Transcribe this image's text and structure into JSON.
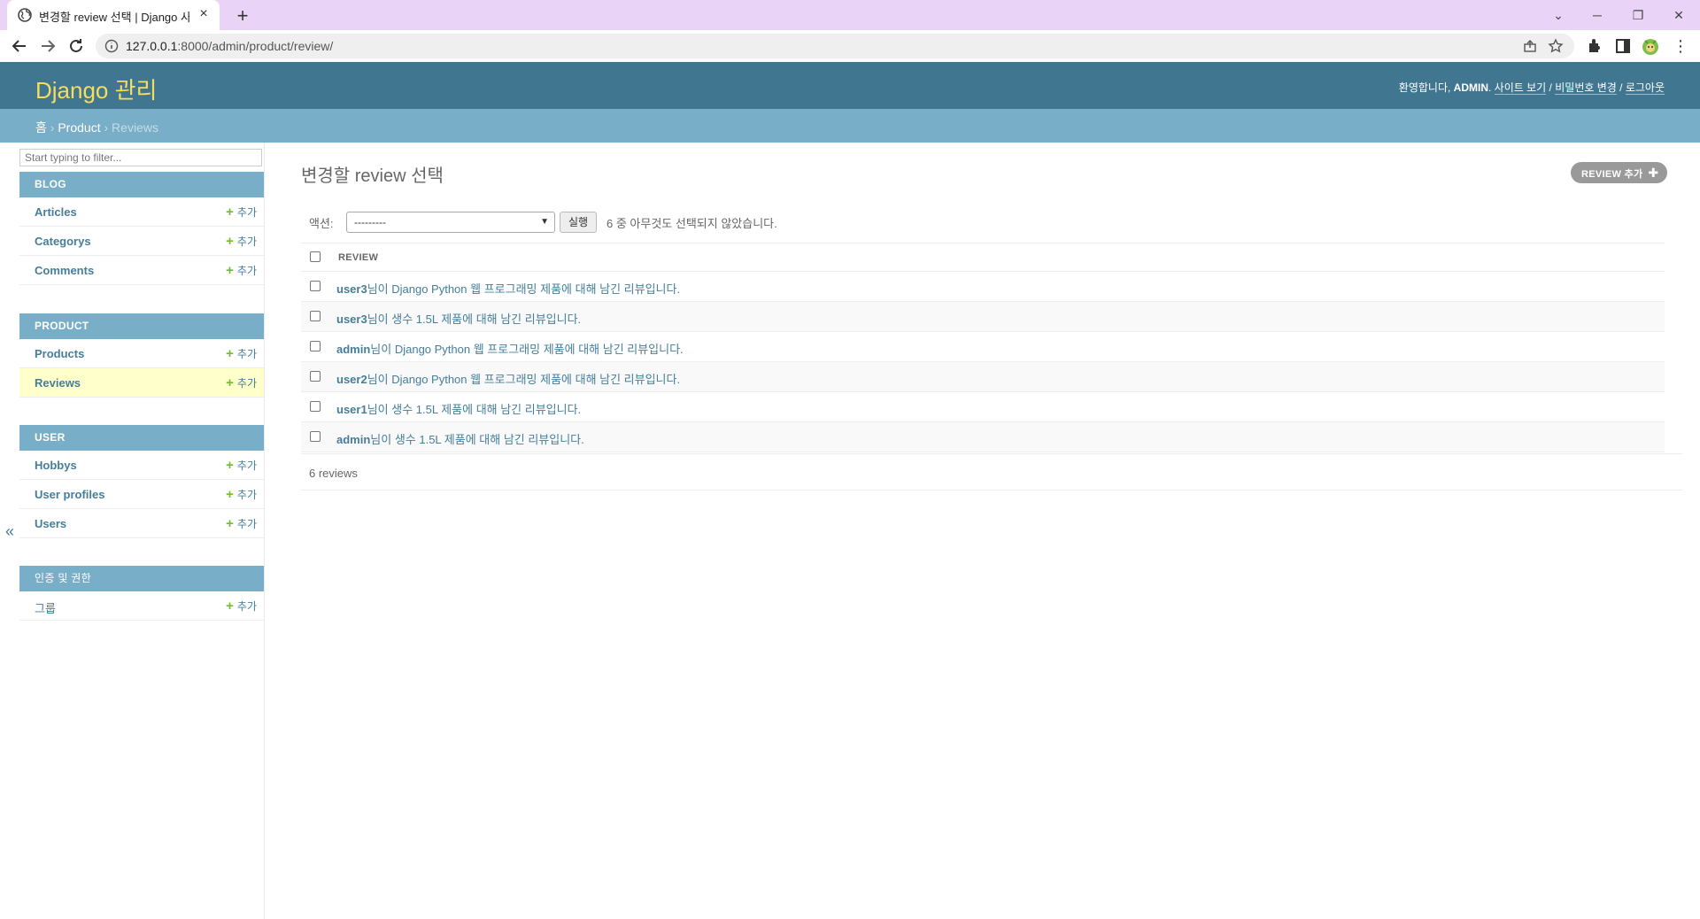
{
  "browser": {
    "tab_title": "변경할 review 선택 | Django 사이트 관리",
    "url_host": "127.0.0.1",
    "url_path": ":8000/admin/product/review/"
  },
  "header": {
    "brand": "Django 관리",
    "welcome": "환영합니다, ",
    "username": "ADMIN",
    "view_site": "사이트 보기",
    "change_password": "비밀번호 변경",
    "logout": "로그아웃",
    "separator": " / "
  },
  "breadcrumbs": {
    "home": "홈",
    "app": "Product",
    "current": "Reviews",
    "sep": " › "
  },
  "sidebar": {
    "filter_placeholder": "Start typing to filter...",
    "add_label": "추가",
    "modules": [
      {
        "caption": "BLOG",
        "models": [
          "Articles",
          "Categorys",
          "Comments"
        ]
      },
      {
        "caption": "PRODUCT",
        "models": [
          "Products",
          "Reviews"
        ]
      },
      {
        "caption": "USER",
        "models": [
          "Hobbys",
          "User profiles",
          "Users"
        ]
      },
      {
        "caption": "인증 및 권한",
        "models": [
          "그룹"
        ]
      }
    ],
    "collapse_label": "«"
  },
  "content": {
    "title": "변경할 review 선택",
    "add_button": "REVIEW 추가",
    "actions_label": "액션:",
    "action_selected": "---------",
    "run_button": "실행",
    "action_counter": "6 중 아무것도 선택되지 않았습니다.",
    "column_header": "REVIEW",
    "rows": [
      {
        "user": "user3",
        "text": "님이 Django Python 웹 프로그래밍 제품에 대해 남긴 리뷰입니다."
      },
      {
        "user": "user3",
        "text": "님이 생수 1.5L 제품에 대해 남긴 리뷰입니다."
      },
      {
        "user": "admin",
        "text": "님이 Django Python 웹 프로그래밍 제품에 대해 남긴 리뷰입니다."
      },
      {
        "user": "user2",
        "text": "님이 Django Python 웹 프로그래밍 제품에 대해 남긴 리뷰입니다."
      },
      {
        "user": "user1",
        "text": "님이 생수 1.5L 제품에 대해 남긴 리뷰입니다."
      },
      {
        "user": "admin",
        "text": "님이 생수 1.5L 제품에 대해 남긴 리뷰입니다."
      }
    ],
    "paginator": "6 reviews"
  },
  "colors": {
    "header": "#417690",
    "breadcrumbs": "#79aec8",
    "brand": "#f5dd5d",
    "link": "#447e9b",
    "add_green": "#70bf2b",
    "current_row": "#ffffcc",
    "tabstrip": "#e9d3f7"
  }
}
